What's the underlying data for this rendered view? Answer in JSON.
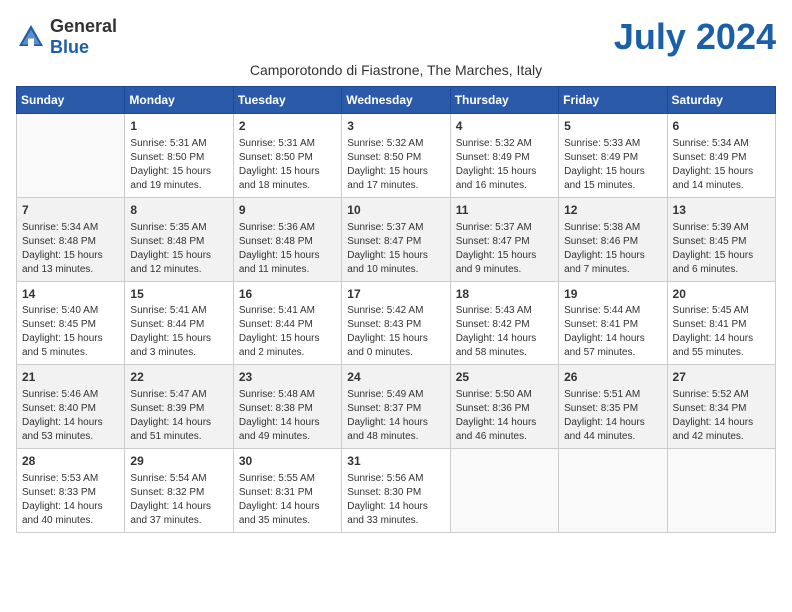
{
  "logo": {
    "general": "General",
    "blue": "Blue"
  },
  "title": "July 2024",
  "location": "Camporotondo di Fiastrone, The Marches, Italy",
  "days_of_week": [
    "Sunday",
    "Monday",
    "Tuesday",
    "Wednesday",
    "Thursday",
    "Friday",
    "Saturday"
  ],
  "weeks": [
    [
      {
        "day": "",
        "info": ""
      },
      {
        "day": "1",
        "info": "Sunrise: 5:31 AM\nSunset: 8:50 PM\nDaylight: 15 hours\nand 19 minutes."
      },
      {
        "day": "2",
        "info": "Sunrise: 5:31 AM\nSunset: 8:50 PM\nDaylight: 15 hours\nand 18 minutes."
      },
      {
        "day": "3",
        "info": "Sunrise: 5:32 AM\nSunset: 8:50 PM\nDaylight: 15 hours\nand 17 minutes."
      },
      {
        "day": "4",
        "info": "Sunrise: 5:32 AM\nSunset: 8:49 PM\nDaylight: 15 hours\nand 16 minutes."
      },
      {
        "day": "5",
        "info": "Sunrise: 5:33 AM\nSunset: 8:49 PM\nDaylight: 15 hours\nand 15 minutes."
      },
      {
        "day": "6",
        "info": "Sunrise: 5:34 AM\nSunset: 8:49 PM\nDaylight: 15 hours\nand 14 minutes."
      }
    ],
    [
      {
        "day": "7",
        "info": "Sunrise: 5:34 AM\nSunset: 8:48 PM\nDaylight: 15 hours\nand 13 minutes."
      },
      {
        "day": "8",
        "info": "Sunrise: 5:35 AM\nSunset: 8:48 PM\nDaylight: 15 hours\nand 12 minutes."
      },
      {
        "day": "9",
        "info": "Sunrise: 5:36 AM\nSunset: 8:48 PM\nDaylight: 15 hours\nand 11 minutes."
      },
      {
        "day": "10",
        "info": "Sunrise: 5:37 AM\nSunset: 8:47 PM\nDaylight: 15 hours\nand 10 minutes."
      },
      {
        "day": "11",
        "info": "Sunrise: 5:37 AM\nSunset: 8:47 PM\nDaylight: 15 hours\nand 9 minutes."
      },
      {
        "day": "12",
        "info": "Sunrise: 5:38 AM\nSunset: 8:46 PM\nDaylight: 15 hours\nand 7 minutes."
      },
      {
        "day": "13",
        "info": "Sunrise: 5:39 AM\nSunset: 8:45 PM\nDaylight: 15 hours\nand 6 minutes."
      }
    ],
    [
      {
        "day": "14",
        "info": "Sunrise: 5:40 AM\nSunset: 8:45 PM\nDaylight: 15 hours\nand 5 minutes."
      },
      {
        "day": "15",
        "info": "Sunrise: 5:41 AM\nSunset: 8:44 PM\nDaylight: 15 hours\nand 3 minutes."
      },
      {
        "day": "16",
        "info": "Sunrise: 5:41 AM\nSunset: 8:44 PM\nDaylight: 15 hours\nand 2 minutes."
      },
      {
        "day": "17",
        "info": "Sunrise: 5:42 AM\nSunset: 8:43 PM\nDaylight: 15 hours\nand 0 minutes."
      },
      {
        "day": "18",
        "info": "Sunrise: 5:43 AM\nSunset: 8:42 PM\nDaylight: 14 hours\nand 58 minutes."
      },
      {
        "day": "19",
        "info": "Sunrise: 5:44 AM\nSunset: 8:41 PM\nDaylight: 14 hours\nand 57 minutes."
      },
      {
        "day": "20",
        "info": "Sunrise: 5:45 AM\nSunset: 8:41 PM\nDaylight: 14 hours\nand 55 minutes."
      }
    ],
    [
      {
        "day": "21",
        "info": "Sunrise: 5:46 AM\nSunset: 8:40 PM\nDaylight: 14 hours\nand 53 minutes."
      },
      {
        "day": "22",
        "info": "Sunrise: 5:47 AM\nSunset: 8:39 PM\nDaylight: 14 hours\nand 51 minutes."
      },
      {
        "day": "23",
        "info": "Sunrise: 5:48 AM\nSunset: 8:38 PM\nDaylight: 14 hours\nand 49 minutes."
      },
      {
        "day": "24",
        "info": "Sunrise: 5:49 AM\nSunset: 8:37 PM\nDaylight: 14 hours\nand 48 minutes."
      },
      {
        "day": "25",
        "info": "Sunrise: 5:50 AM\nSunset: 8:36 PM\nDaylight: 14 hours\nand 46 minutes."
      },
      {
        "day": "26",
        "info": "Sunrise: 5:51 AM\nSunset: 8:35 PM\nDaylight: 14 hours\nand 44 minutes."
      },
      {
        "day": "27",
        "info": "Sunrise: 5:52 AM\nSunset: 8:34 PM\nDaylight: 14 hours\nand 42 minutes."
      }
    ],
    [
      {
        "day": "28",
        "info": "Sunrise: 5:53 AM\nSunset: 8:33 PM\nDaylight: 14 hours\nand 40 minutes."
      },
      {
        "day": "29",
        "info": "Sunrise: 5:54 AM\nSunset: 8:32 PM\nDaylight: 14 hours\nand 37 minutes."
      },
      {
        "day": "30",
        "info": "Sunrise: 5:55 AM\nSunset: 8:31 PM\nDaylight: 14 hours\nand 35 minutes."
      },
      {
        "day": "31",
        "info": "Sunrise: 5:56 AM\nSunset: 8:30 PM\nDaylight: 14 hours\nand 33 minutes."
      },
      {
        "day": "",
        "info": ""
      },
      {
        "day": "",
        "info": ""
      },
      {
        "day": "",
        "info": ""
      }
    ]
  ]
}
